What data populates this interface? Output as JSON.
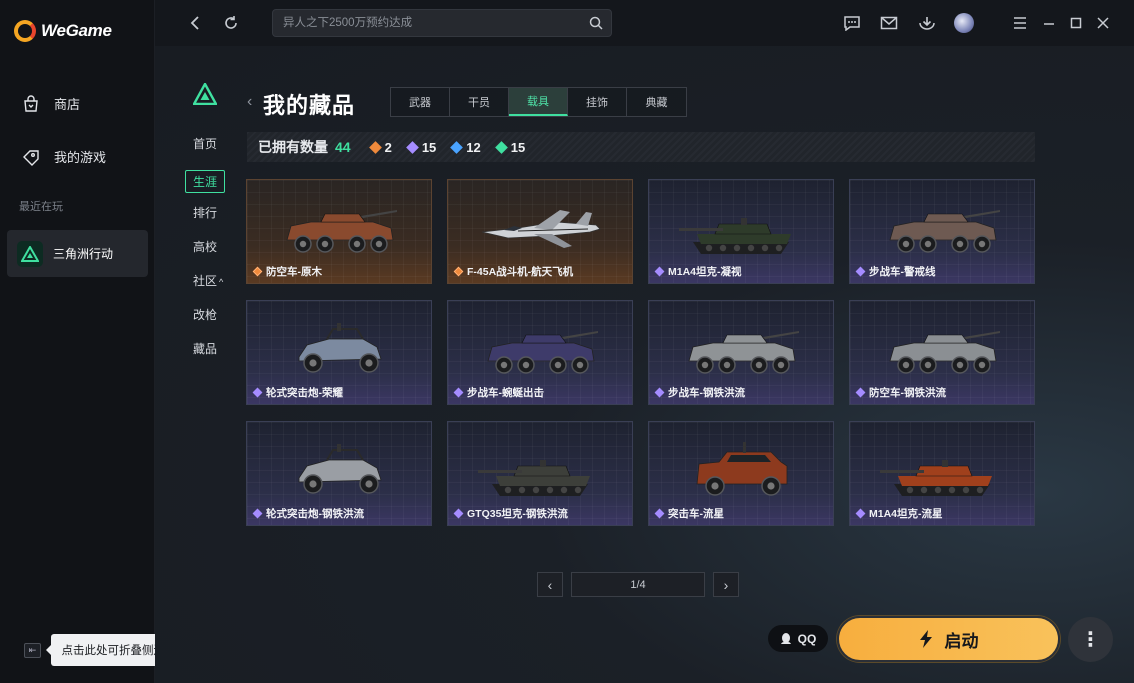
{
  "app": {
    "name": "WeGame"
  },
  "sidebar": {
    "store_label": "商店",
    "my_games_label": "我的游戏",
    "recent_label": "最近在玩",
    "recent_game": "三角洲行动",
    "collapse_tip": "点击此处可折叠侧边栏"
  },
  "topbar": {
    "search_placeholder": "异人之下2500万预约达成"
  },
  "game_nav": {
    "items": [
      "首页",
      "生涯",
      "排行",
      "高校",
      "社区",
      "改枪",
      "藏品"
    ],
    "active_index": 1,
    "community_suffix": "^"
  },
  "collection": {
    "title": "我的藏品",
    "tabs": [
      "武器",
      "干员",
      "载具",
      "挂饰",
      "典藏"
    ],
    "active_tab": 2,
    "owned_label": "已拥有数量",
    "owned_count": "44",
    "stats": [
      {
        "color": "#f08a3c",
        "value": "2"
      },
      {
        "color": "#a58cff",
        "value": "15"
      },
      {
        "color": "#4aa3ff",
        "value": "12"
      },
      {
        "color": "#3fe0a0",
        "value": "15"
      }
    ],
    "items": [
      {
        "name": "防空车-原木",
        "rarity": "orange",
        "vehicle": "apc",
        "paint": "#8a4a2e"
      },
      {
        "name": "F-45A战斗机-航天飞机",
        "rarity": "orange",
        "vehicle": "jet",
        "paint": "#cfd2d6"
      },
      {
        "name": "M1A4坦克-凝视",
        "rarity": "purple",
        "vehicle": "tank",
        "paint": "#2e3b2a"
      },
      {
        "name": "步战车-警戒线",
        "rarity": "purple",
        "vehicle": "apc",
        "paint": "#6e5a52"
      },
      {
        "name": "轮式突击炮-荣耀",
        "rarity": "purple",
        "vehicle": "buggy",
        "paint": "#7c8aa0"
      },
      {
        "name": "步战车-蜿蜒出击",
        "rarity": "purple",
        "vehicle": "apc",
        "paint": "#3e3b6a"
      },
      {
        "name": "步战车-钢铁洪流",
        "rarity": "purple",
        "vehicle": "apc",
        "paint": "#8f9396"
      },
      {
        "name": "防空车-钢铁洪流",
        "rarity": "purple",
        "vehicle": "apc",
        "paint": "#8b8f93"
      },
      {
        "name": "轮式突击炮-钢铁洪流",
        "rarity": "purple",
        "vehicle": "buggy",
        "paint": "#9a9ea4"
      },
      {
        "name": "GTQ35坦克-钢铁洪流",
        "rarity": "purple",
        "vehicle": "tank",
        "paint": "#3d3f3a"
      },
      {
        "name": "突击车-流星",
        "rarity": "purple",
        "vehicle": "truck",
        "paint": "#8d3a1e"
      },
      {
        "name": "M1A4坦克-流星",
        "rarity": "purple",
        "vehicle": "tank",
        "paint": "#a0401c"
      }
    ]
  },
  "pager": {
    "page": "1/4"
  },
  "actions": {
    "qq_label": "QQ",
    "launch_label": "启动",
    "more_label": "⋮"
  }
}
